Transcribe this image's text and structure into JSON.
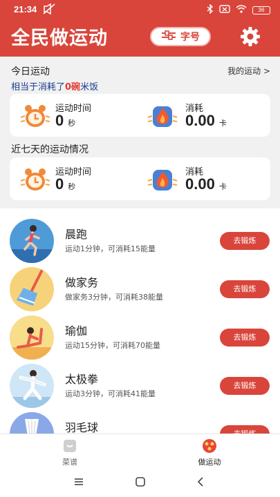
{
  "status": {
    "time": "21:34",
    "battery": "36"
  },
  "header": {
    "title": "全民做运动",
    "font_button": "字号"
  },
  "today": {
    "title": "今日运动",
    "my_link": "我的运动 >",
    "summary_prefix": "相当于消耗了",
    "summary_value": "0碗",
    "summary_suffix": "米饭",
    "time_label": "运动时间",
    "time_value": "0",
    "time_unit": "秒",
    "calorie_label": "消耗",
    "calorie_value": "0.00",
    "calorie_unit": "卡"
  },
  "week": {
    "title": "近七天的运动情况",
    "time_label": "运动时间",
    "time_value": "0",
    "time_unit": "秒",
    "calorie_label": "消耗",
    "calorie_value": "0.00",
    "calorie_unit": "卡"
  },
  "activities": [
    {
      "name": "晨跑",
      "desc": "运动1分钟，可消耗15能量",
      "button": "去锻炼",
      "icon": "running-icon"
    },
    {
      "name": "做家务",
      "desc": "做家务3分钟，可消耗38能量",
      "button": "去锻炼",
      "icon": "broom-icon"
    },
    {
      "name": "瑜伽",
      "desc": "运动15分钟，可消耗70能量",
      "button": "去锻炼",
      "icon": "yoga-icon"
    },
    {
      "name": "太极拳",
      "desc": "运动3分钟，可消耗41能量",
      "button": "去锻炼",
      "icon": "taichi-icon"
    },
    {
      "name": "羽毛球",
      "desc": "",
      "button": "去锻炼",
      "icon": "badminton-icon"
    }
  ],
  "nav": {
    "recipes": "菜谱",
    "exercise": "做运动"
  },
  "colors": {
    "accent": "#d9453b",
    "subtitle": "#1a3d8f"
  }
}
